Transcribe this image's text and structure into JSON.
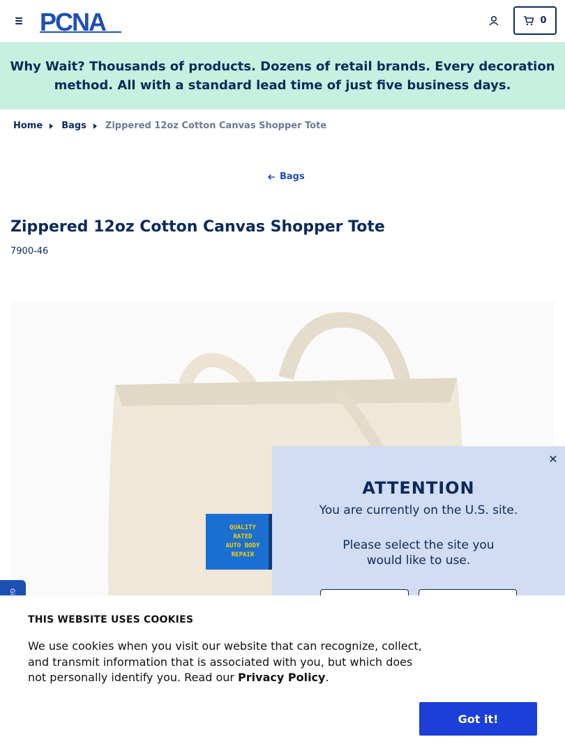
{
  "header": {
    "logo_text": "PCNA",
    "cart_count": "0",
    "menu_icon": "hamburger-icon",
    "account_icon": "user-icon",
    "cart_icon": "cart-icon"
  },
  "promo": {
    "bold_lead": "Why Wait?",
    "text": " Thousands of products. Dozens of retail brands. Every decoration method. All with a standard lead time of just five business days."
  },
  "breadcrumb": {
    "items": [
      {
        "label": "Home"
      },
      {
        "label": "Bags"
      }
    ],
    "current": "Zippered 12oz Cotton Canvas Shopper Tote"
  },
  "back_link": {
    "label": "Bags",
    "icon": "arrow-left-icon"
  },
  "product": {
    "title": "Zippered 12oz Cotton Canvas Shopper Tote",
    "sku": "7900-46",
    "imprint_text": "QUALITY RATED AUTO BODY REPAIR"
  },
  "side_tab": {
    "label": "Gi"
  },
  "modal": {
    "title": "ATTENTION",
    "line1": "You are currently on the U.S. site.",
    "line2": "Please select the site you would like to use."
  },
  "cookie": {
    "title": "THIS WEBSITE USES COOKIES",
    "text_before": "We use cookies when you visit our website that can recognize, collect, and transmit information that is associated with you, but which does not personally identify you. Read our ",
    "link": "Privacy Policy",
    "text_after": ".",
    "button": "Got it!"
  },
  "colors": {
    "navy": "#0b2a5b",
    "promo_bg": "#c8efdf",
    "modal_bg": "#d2dcf2",
    "button_blue": "#1c3fd9"
  }
}
